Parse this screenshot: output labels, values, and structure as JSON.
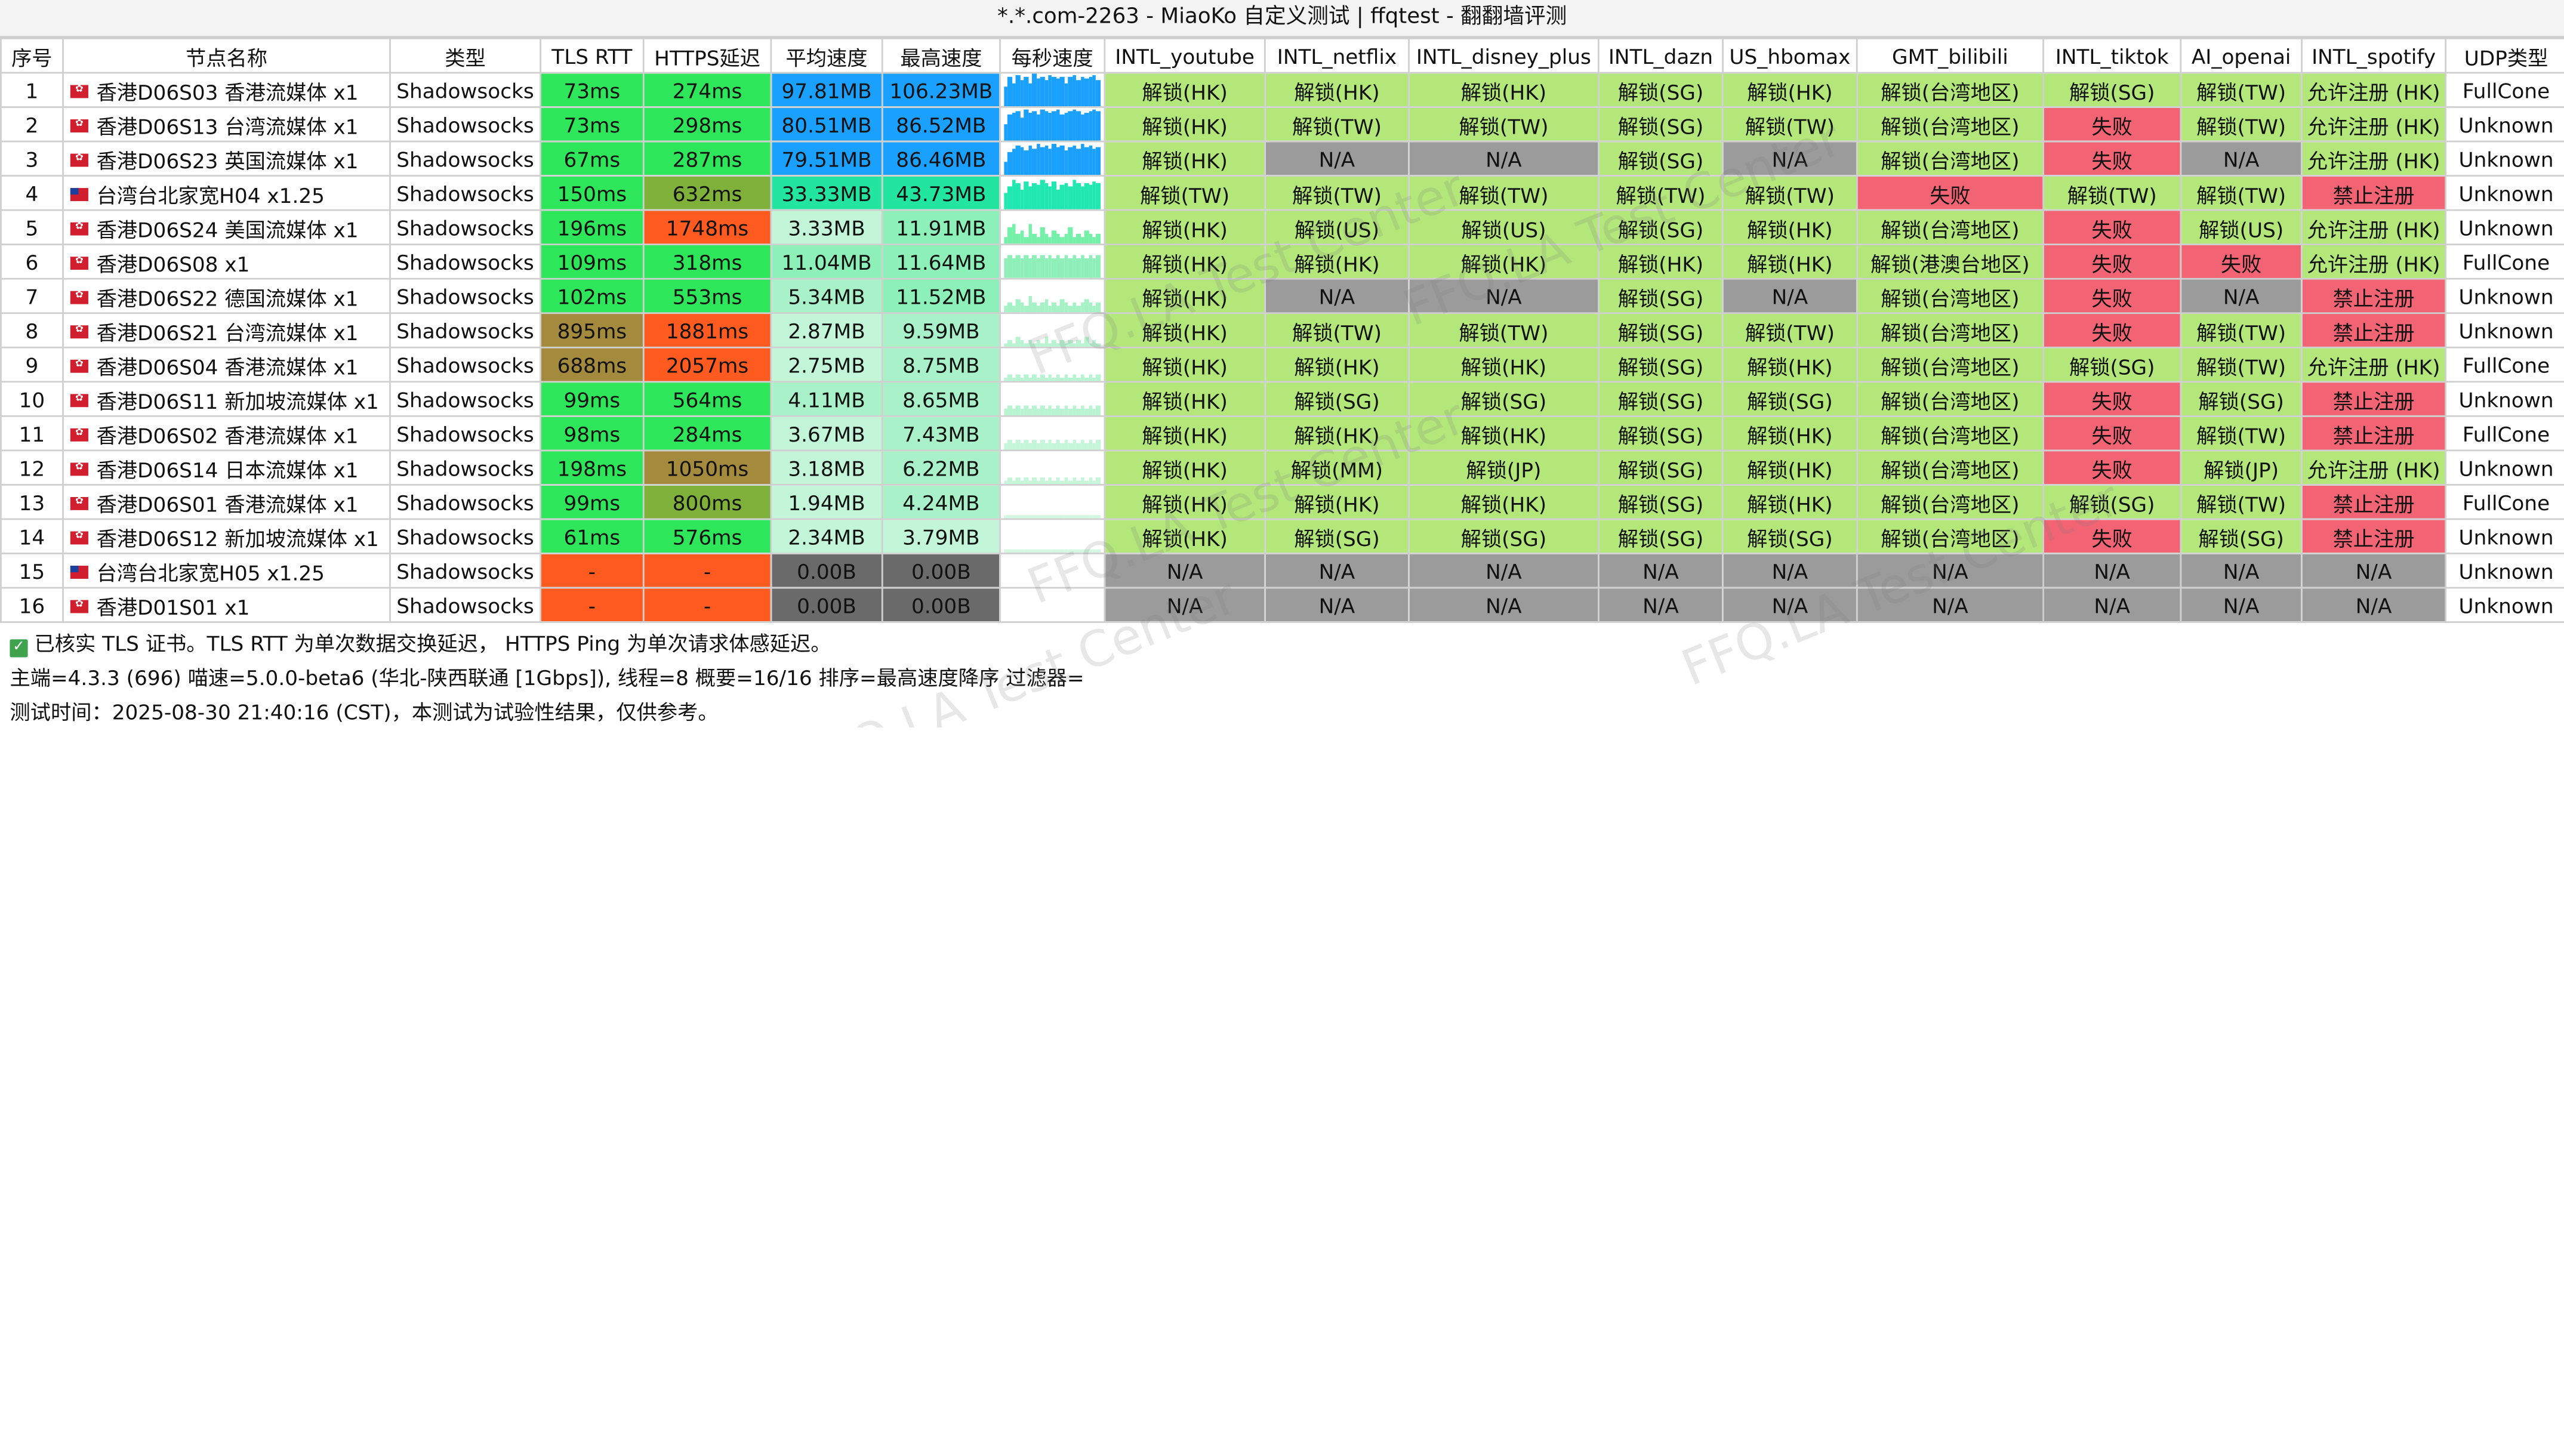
{
  "window": {
    "title": "*.*.com-2263 - MiaoKo 自定义测试 | ffqtest - 翻翻墙评测"
  },
  "colors": {
    "green": "#2ee65a",
    "lightgreen": "#b4e77a",
    "red": "#f26474",
    "blue": "#1aa0ff",
    "gray": "#9b9b9b",
    "orange": "#ff5a1f",
    "olive": "#a48a3c",
    "darkgray": "#6a6a6a"
  },
  "headers": [
    "序号",
    "节点名称",
    "类型",
    "TLS RTT",
    "HTTPS延迟",
    "平均速度",
    "最高速度",
    "每秒速度",
    "INTL_youtube",
    "INTL_netflix",
    "INTL_disney_plus",
    "INTL_dazn",
    "US_hbomax",
    "GMT_bilibili",
    "INTL_tiktok",
    "AI_openai",
    "INTL_spotify",
    "UDP类型"
  ],
  "rows": [
    {
      "id": "1",
      "flag": "hk",
      "name": "香港D06S03 香港流媒体 x1",
      "type": "Shadowsocks",
      "tls": "73ms",
      "https": "274ms",
      "avg": "97.81MB",
      "max": "106.23MB",
      "bars": [
        0.6,
        0.9,
        0.7,
        0.95,
        0.8,
        0.9,
        0.7,
        1,
        0.85,
        0.9,
        0.8,
        0.95,
        0.9,
        0.85,
        0.9,
        0.7,
        0.9,
        0.95,
        0.8,
        0.9,
        0.85,
        0.9,
        0.95,
        0.8
      ],
      "barColor": "#1aa0ff",
      "yt": "解锁(HK)",
      "nf": "解锁(HK)",
      "dp": "解锁(HK)",
      "dz": "解锁(SG)",
      "hbo": "解锁(HK)",
      "bili": "解锁(台湾地区)",
      "tt": "解锁(SG)",
      "ai": "解锁(TW)",
      "sp": "允许注册 (HK)",
      "udp": "FullCone"
    },
    {
      "id": "2",
      "flag": "hk",
      "name": "香港D06S13 台湾流媒体 x1",
      "type": "Shadowsocks",
      "tls": "73ms",
      "https": "298ms",
      "avg": "80.51MB",
      "max": "86.52MB",
      "bars": [
        0.5,
        0.8,
        0.85,
        0.9,
        0.7,
        0.95,
        0.85,
        0.9,
        0.8,
        0.95,
        0.9,
        0.85,
        0.9,
        0.95,
        0.8,
        0.85,
        0.9,
        0.95,
        0.9,
        0.8,
        0.85,
        0.9,
        0.95,
        0.9
      ],
      "barColor": "#1aa0ff",
      "yt": "解锁(HK)",
      "nf": "解锁(TW)",
      "dp": "解锁(TW)",
      "dz": "解锁(SG)",
      "hbo": "解锁(TW)",
      "bili": "解锁(台湾地区)",
      "tt": "失败",
      "ai": "解锁(TW)",
      "sp": "允许注册 (HK)",
      "udp": "Unknown"
    },
    {
      "id": "3",
      "flag": "hk",
      "name": "香港D06S23 英国流媒体 x1",
      "type": "Shadowsocks",
      "tls": "67ms",
      "https": "287ms",
      "avg": "79.51MB",
      "max": "86.46MB",
      "bars": [
        0.4,
        0.7,
        0.8,
        0.9,
        0.85,
        0.75,
        0.9,
        0.8,
        0.95,
        0.85,
        0.9,
        0.8,
        0.95,
        0.85,
        0.9,
        0.75,
        0.85,
        0.9,
        0.8,
        0.95,
        0.85,
        0.9,
        0.8,
        0.85
      ],
      "barColor": "#1aa0ff",
      "yt": "解锁(HK)",
      "nf": "N/A",
      "dp": "N/A",
      "dz": "解锁(SG)",
      "hbo": "N/A",
      "bili": "解锁(台湾地区)",
      "tt": "失败",
      "ai": "N/A",
      "sp": "允许注册 (HK)",
      "udp": "Unknown"
    },
    {
      "id": "4",
      "flag": "tw",
      "name": "台湾台北家宽H04 x1.25",
      "type": "Shadowsocks",
      "tls": "150ms",
      "https": "632ms",
      "avg": "33.33MB",
      "max": "43.73MB",
      "bars": [
        0.5,
        0.7,
        0.9,
        0.8,
        0.6,
        0.85,
        0.7,
        0.8,
        0.75,
        0.9,
        0.8,
        0.7,
        0.85,
        0.6,
        0.75,
        0.8,
        0.7,
        0.9,
        0.8,
        0.7,
        0.8,
        0.75,
        0.85,
        0.8
      ],
      "barColor": "#21e7b0",
      "yt": "解锁(TW)",
      "nf": "解锁(TW)",
      "dp": "解锁(TW)",
      "dz": "解锁(TW)",
      "hbo": "解锁(TW)",
      "bili": "失败",
      "tt": "解锁(TW)",
      "ai": "解锁(TW)",
      "sp": "禁止注册",
      "udp": "Unknown"
    },
    {
      "id": "5",
      "flag": "hk",
      "name": "香港D06S24 美国流媒体 x1",
      "type": "Shadowsocks",
      "tls": "196ms",
      "https": "1748ms",
      "avg": "3.33MB",
      "max": "11.91MB",
      "bars": [
        0.2,
        0.5,
        0.6,
        0.3,
        0.4,
        0.2,
        0.6,
        0.3,
        0.2,
        0.5,
        0.3,
        0.2,
        0.4,
        0.3,
        0.2,
        0.3,
        0.5,
        0.2,
        0.3,
        0.2,
        0.4,
        0.3,
        0.2,
        0.3
      ],
      "barColor": "#74f0a8",
      "yt": "解锁(HK)",
      "nf": "解锁(US)",
      "dp": "解锁(US)",
      "dz": "解锁(SG)",
      "hbo": "解锁(HK)",
      "bili": "解锁(台湾地区)",
      "tt": "失败",
      "ai": "解锁(US)",
      "sp": "允许注册 (HK)",
      "udp": "Unknown"
    },
    {
      "id": "6",
      "flag": "hk",
      "name": "香港D06S08 x1",
      "type": "Shadowsocks",
      "tls": "109ms",
      "https": "318ms",
      "avg": "11.04MB",
      "max": "11.64MB",
      "bars": [
        0.6,
        0.7,
        0.6,
        0.7,
        0.6,
        0.7,
        0.6,
        0.7,
        0.6,
        0.7,
        0.6,
        0.7,
        0.6,
        0.7,
        0.6,
        0.7,
        0.6,
        0.7,
        0.6,
        0.7,
        0.6,
        0.7,
        0.6,
        0.7
      ],
      "barColor": "#8fefb8",
      "yt": "解锁(HK)",
      "nf": "解锁(HK)",
      "dp": "解锁(HK)",
      "dz": "解锁(HK)",
      "hbo": "解锁(HK)",
      "bili": "解锁(港澳台地区)",
      "tt": "失败",
      "ai": "失败",
      "sp": "允许注册 (HK)",
      "udp": "FullCone"
    },
    {
      "id": "7",
      "flag": "hk",
      "name": "香港D06S22 德国流媒体 x1",
      "type": "Shadowsocks",
      "tls": "102ms",
      "https": "553ms",
      "avg": "5.34MB",
      "max": "11.52MB",
      "bars": [
        0.2,
        0.3,
        0.2,
        0.4,
        0.3,
        0.2,
        0.5,
        0.3,
        0.2,
        0.3,
        0.4,
        0.2,
        0.3,
        0.2,
        0.4,
        0.3,
        0.2,
        0.3,
        0.2,
        0.3,
        0.4,
        0.3,
        0.2,
        0.3
      ],
      "barColor": "#a6f2c6",
      "yt": "解锁(HK)",
      "nf": "N/A",
      "dp": "N/A",
      "dz": "解锁(SG)",
      "hbo": "N/A",
      "bili": "解锁(台湾地区)",
      "tt": "失败",
      "ai": "N/A",
      "sp": "禁止注册",
      "udp": "Unknown"
    },
    {
      "id": "8",
      "flag": "hk",
      "name": "香港D06S21 台湾流媒体 x1",
      "type": "Shadowsocks",
      "tls": "895ms",
      "https": "1881ms",
      "avg": "2.87MB",
      "max": "9.59MB",
      "bars": [
        0.1,
        0.2,
        0.1,
        0.3,
        0.2,
        0.1,
        0.2,
        0.1,
        0.2,
        0.1,
        0.3,
        0.1,
        0.2,
        0.1,
        0.2,
        0.1,
        0.2,
        0.1,
        0.2,
        0.1,
        0.3,
        0.1,
        0.2,
        0.1
      ],
      "barColor": "#b8f4d2",
      "yt": "解锁(HK)",
      "nf": "解锁(TW)",
      "dp": "解锁(TW)",
      "dz": "解锁(SG)",
      "hbo": "解锁(TW)",
      "bili": "解锁(台湾地区)",
      "tt": "失败",
      "ai": "解锁(TW)",
      "sp": "禁止注册",
      "udp": "Unknown"
    },
    {
      "id": "9",
      "flag": "hk",
      "name": "香港D06S04 香港流媒体 x1",
      "type": "Shadowsocks",
      "tls": "688ms",
      "https": "2057ms",
      "avg": "2.75MB",
      "max": "8.75MB",
      "bars": [
        0.1,
        0.2,
        0.1,
        0.2,
        0.1,
        0.2,
        0.1,
        0.2,
        0.1,
        0.2,
        0.1,
        0.2,
        0.1,
        0.2,
        0.1,
        0.2,
        0.1,
        0.2,
        0.1,
        0.2,
        0.1,
        0.2,
        0.1,
        0.2
      ],
      "barColor": "#b8f4d2",
      "yt": "解锁(HK)",
      "nf": "解锁(HK)",
      "dp": "解锁(HK)",
      "dz": "解锁(SG)",
      "hbo": "解锁(HK)",
      "bili": "解锁(台湾地区)",
      "tt": "解锁(SG)",
      "ai": "解锁(TW)",
      "sp": "允许注册 (HK)",
      "udp": "FullCone"
    },
    {
      "id": "10",
      "flag": "hk",
      "name": "香港D06S11 新加坡流媒体 x1",
      "type": "Shadowsocks",
      "tls": "99ms",
      "https": "564ms",
      "avg": "4.11MB",
      "max": "8.65MB",
      "bars": [
        0.2,
        0.3,
        0.2,
        0.3,
        0.2,
        0.3,
        0.2,
        0.3,
        0.2,
        0.3,
        0.2,
        0.3,
        0.2,
        0.3,
        0.2,
        0.3,
        0.2,
        0.3,
        0.2,
        0.3,
        0.2,
        0.3,
        0.2,
        0.3
      ],
      "barColor": "#b8f4d2",
      "yt": "解锁(HK)",
      "nf": "解锁(SG)",
      "dp": "解锁(SG)",
      "dz": "解锁(SG)",
      "hbo": "解锁(SG)",
      "bili": "解锁(台湾地区)",
      "tt": "失败",
      "ai": "解锁(SG)",
      "sp": "禁止注册",
      "udp": "Unknown"
    },
    {
      "id": "11",
      "flag": "hk",
      "name": "香港D06S02 香港流媒体 x1",
      "type": "Shadowsocks",
      "tls": "98ms",
      "https": "284ms",
      "avg": "3.67MB",
      "max": "7.43MB",
      "bars": [
        0.2,
        0.3,
        0.2,
        0.3,
        0.2,
        0.3,
        0.2,
        0.3,
        0.2,
        0.3,
        0.2,
        0.3,
        0.2,
        0.3,
        0.2,
        0.3,
        0.2,
        0.3,
        0.2,
        0.3,
        0.2,
        0.3,
        0.2,
        0.3
      ],
      "barColor": "#c6f6da",
      "yt": "解锁(HK)",
      "nf": "解锁(HK)",
      "dp": "解锁(HK)",
      "dz": "解锁(SG)",
      "hbo": "解锁(HK)",
      "bili": "解锁(台湾地区)",
      "tt": "失败",
      "ai": "解锁(TW)",
      "sp": "禁止注册",
      "udp": "FullCone"
    },
    {
      "id": "12",
      "flag": "hk",
      "name": "香港D06S14 日本流媒体 x1",
      "type": "Shadowsocks",
      "tls": "198ms",
      "https": "1050ms",
      "avg": "3.18MB",
      "max": "6.22MB",
      "bars": [
        0.1,
        0.2,
        0.1,
        0.2,
        0.1,
        0.2,
        0.1,
        0.2,
        0.1,
        0.2,
        0.1,
        0.2,
        0.1,
        0.2,
        0.1,
        0.2,
        0.1,
        0.2,
        0.1,
        0.2,
        0.1,
        0.2,
        0.1,
        0.2
      ],
      "barColor": "#c6f6da",
      "yt": "解锁(HK)",
      "nf": "解锁(MM)",
      "dp": "解锁(JP)",
      "dz": "解锁(SG)",
      "hbo": "解锁(HK)",
      "bili": "解锁(台湾地区)",
      "tt": "失败",
      "ai": "解锁(JP)",
      "sp": "允许注册 (HK)",
      "udp": "Unknown"
    },
    {
      "id": "13",
      "flag": "hk",
      "name": "香港D06S01 香港流媒体 x1",
      "type": "Shadowsocks",
      "tls": "99ms",
      "https": "800ms",
      "avg": "1.94MB",
      "max": "4.24MB",
      "bars": [
        0.1,
        0.1,
        0.1,
        0.1,
        0.1,
        0.1,
        0.1,
        0.1,
        0.1,
        0.1,
        0.1,
        0.1,
        0.1,
        0.1,
        0.1,
        0.1,
        0.1,
        0.1,
        0.1,
        0.1,
        0.1,
        0.1,
        0.1,
        0.1
      ],
      "barColor": "#d4f8e2",
      "yt": "解锁(HK)",
      "nf": "解锁(HK)",
      "dp": "解锁(HK)",
      "dz": "解锁(SG)",
      "hbo": "解锁(HK)",
      "bili": "解锁(台湾地区)",
      "tt": "解锁(SG)",
      "ai": "解锁(TW)",
      "sp": "禁止注册",
      "udp": "FullCone"
    },
    {
      "id": "14",
      "flag": "hk",
      "name": "香港D06S12 新加坡流媒体 x1",
      "type": "Shadowsocks",
      "tls": "61ms",
      "https": "576ms",
      "avg": "2.34MB",
      "max": "3.79MB",
      "bars": [
        0.1,
        0.1,
        0.1,
        0.1,
        0.1,
        0.1,
        0.1,
        0.1,
        0.1,
        0.1,
        0.1,
        0.1,
        0.1,
        0.1,
        0.1,
        0.1,
        0.1,
        0.1,
        0.1,
        0.1,
        0.1,
        0.1,
        0.1,
        0.1
      ],
      "barColor": "#d4f8e2",
      "yt": "解锁(HK)",
      "nf": "解锁(SG)",
      "dp": "解锁(SG)",
      "dz": "解锁(SG)",
      "hbo": "解锁(SG)",
      "bili": "解锁(台湾地区)",
      "tt": "失败",
      "ai": "解锁(SG)",
      "sp": "禁止注册",
      "udp": "Unknown"
    },
    {
      "id": "15",
      "flag": "tw",
      "name": "台湾台北家宽H05 x1.25",
      "type": "Shadowsocks",
      "tls": "-",
      "https": "-",
      "avg": "0.00B",
      "max": "0.00B",
      "bars": [],
      "barColor": "#ffffff",
      "yt": "N/A",
      "nf": "N/A",
      "dp": "N/A",
      "dz": "N/A",
      "hbo": "N/A",
      "bili": "N/A",
      "tt": "N/A",
      "ai": "N/A",
      "sp": "N/A",
      "udp": "Unknown"
    },
    {
      "id": "16",
      "flag": "hk",
      "name": "香港D01S01 x1",
      "type": "Shadowsocks",
      "tls": "-",
      "https": "-",
      "avg": "0.00B",
      "max": "0.00B",
      "bars": [],
      "barColor": "#ffffff",
      "yt": "N/A",
      "nf": "N/A",
      "dp": "N/A",
      "dz": "N/A",
      "hbo": "N/A",
      "bili": "N/A",
      "tt": "N/A",
      "ai": "N/A",
      "sp": "N/A",
      "udp": "Unknown"
    }
  ],
  "footer": {
    "tls_note": "已核实 TLS 证书。TLS RTT 为单次数据交换延迟， HTTPS Ping 为单次请求体感延迟。",
    "info": "主端=4.3.3 (696) 喵速=5.0.0-beta6 (华北-陕西联通 [1Gbps]), 线程=8 概要=16/16 排序=最高速度降序 过滤器=",
    "time": "测试时间：2025-08-30 21:40:16 (CST)，本测试为试验性结果，仅供参考。"
  },
  "watermark": "FFQ.LA Test Center"
}
